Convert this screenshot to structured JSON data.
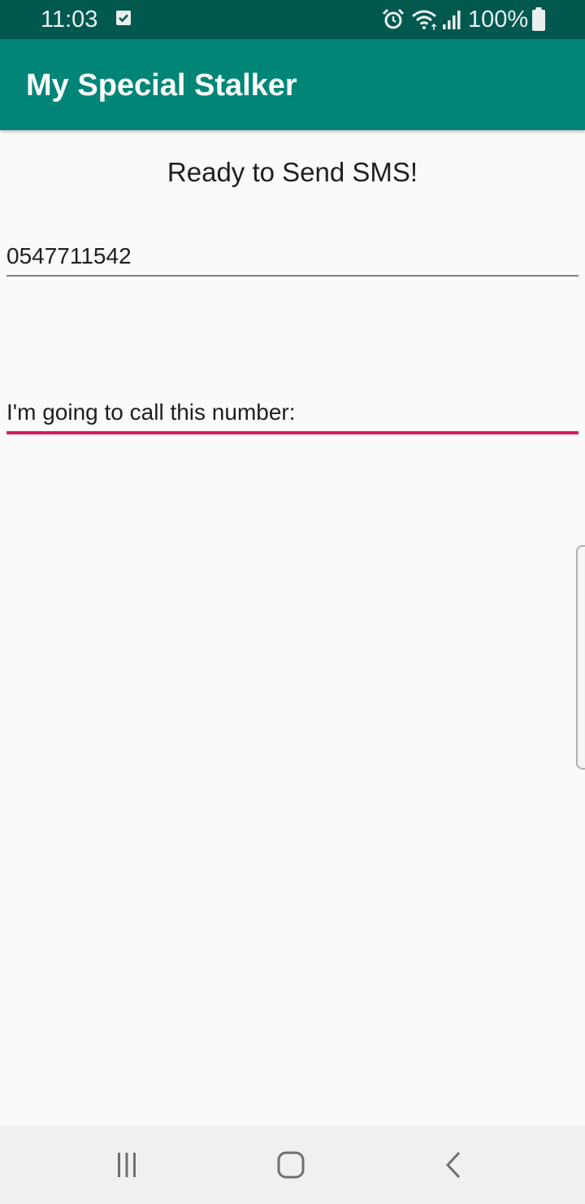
{
  "status_bar": {
    "time": "11:03",
    "battery": "100%"
  },
  "app_bar": {
    "title": "My Special Stalker"
  },
  "main": {
    "heading": "Ready to Send SMS!",
    "phone_field": {
      "value": "0547711542"
    },
    "message_field": {
      "value": "I'm going to call this number:"
    }
  },
  "icons": {
    "notification": "checkbox-notification-icon",
    "alarm": "alarm-icon",
    "wifi": "wifi-icon",
    "signal": "signal-icon",
    "battery": "battery-icon",
    "nav_recent": "recent-apps-icon",
    "nav_home": "home-icon",
    "nav_back": "back-icon"
  },
  "colors": {
    "status_bar": "#00584f",
    "app_bar": "#008577",
    "accent": "#d81b60",
    "background": "#fafafa"
  }
}
